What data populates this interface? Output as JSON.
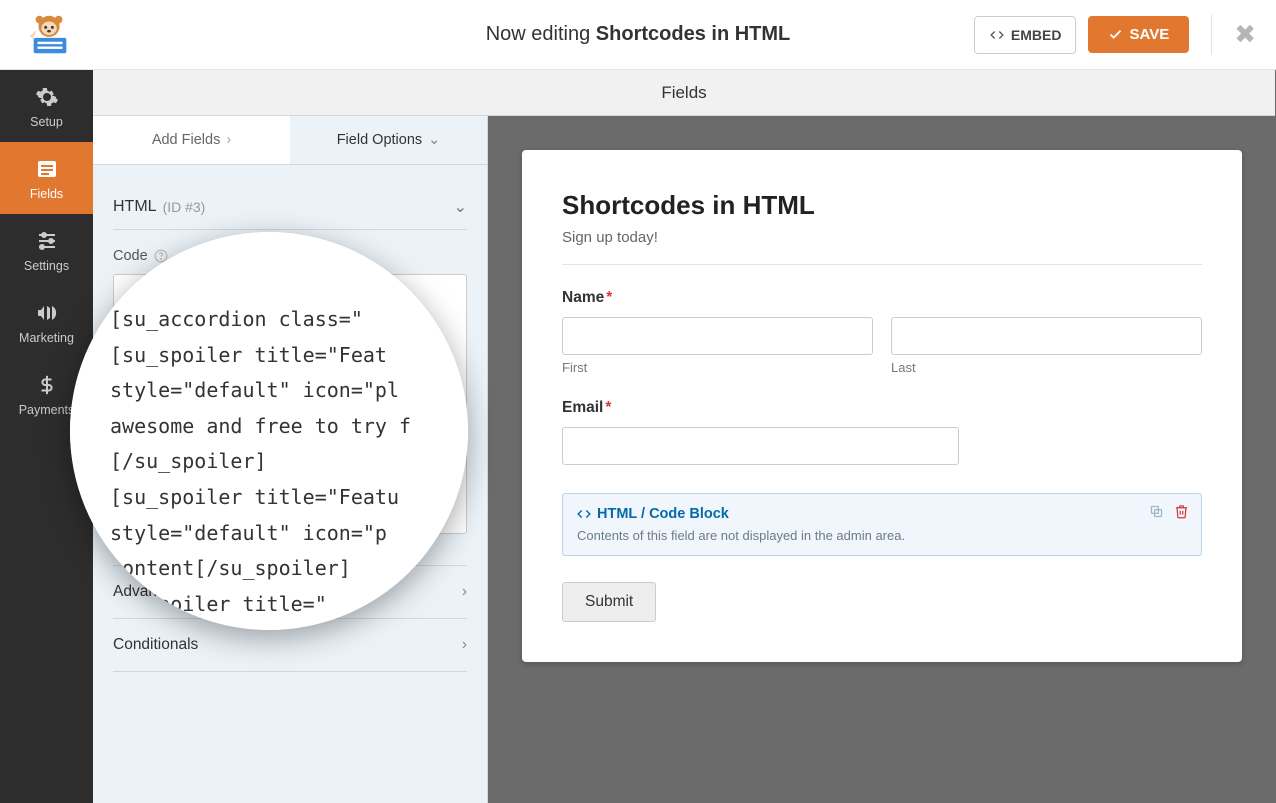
{
  "header": {
    "editing_prefix": "Now editing ",
    "editing_title": "Shortcodes in HTML",
    "embed_label": "EMBED",
    "save_label": "SAVE"
  },
  "sidebar": {
    "items": [
      {
        "label": "Setup"
      },
      {
        "label": "Fields"
      },
      {
        "label": "Settings"
      },
      {
        "label": "Marketing"
      },
      {
        "label": "Payments"
      }
    ]
  },
  "panel": {
    "top_title": "Fields",
    "tabs": {
      "add": "Add Fields",
      "options": "Field Options"
    },
    "field_name": "HTML",
    "field_id": "(ID #3)",
    "code_label": "Code",
    "code_value": "",
    "advanced_label": "Advanced",
    "conditionals_label": "Conditionals"
  },
  "form": {
    "title": "Shortcodes in HTML",
    "desc": "Sign up today!",
    "name_label": "Name",
    "first_label": "First",
    "last_label": "Last",
    "email_label": "Email",
    "codeblock_title": "HTML / Code Block",
    "codeblock_desc": "Contents of this field are not displayed in the admin area.",
    "submit_label": "Submit"
  },
  "magnifier": {
    "text": "[su_accordion class=\"\n[su_spoiler title=\"Feat\nstyle=\"default\" icon=\"pl\nawesome and free to try f\n[/su_spoiler]\n[su_spoiler title=\"Featu\nstyle=\"default\" icon=\"p\ncontent[/su_spoiler]\n   spoiler title=\""
  }
}
